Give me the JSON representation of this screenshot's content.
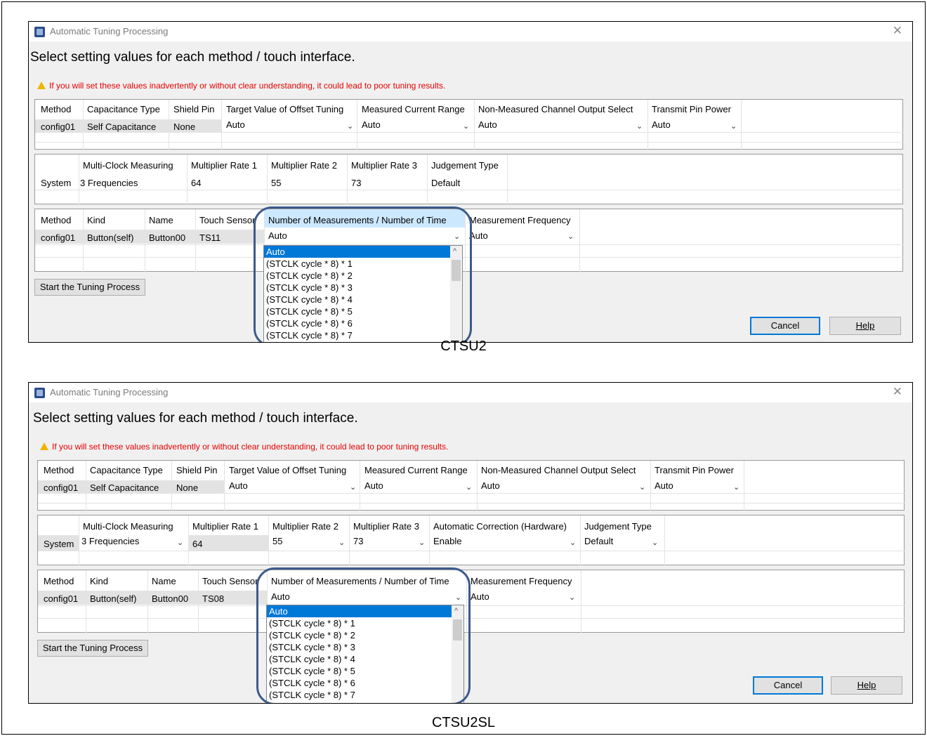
{
  "dialog_title": "Automatic Tuning Processing",
  "heading": "Select setting values for each method / touch interface.",
  "warning": "If you will set these values inadvertently or without clear understanding, it could lead to poor tuning results.",
  "method_table": {
    "headers": [
      "Method",
      "Capacitance Type",
      "Shield Pin",
      "Target Value of Offset Tuning",
      "Measured Current Range",
      "Non-Measured Channel Output Select",
      "Transmit Pin Power"
    ],
    "row": [
      "config01",
      "Self Capacitance",
      "None",
      "Auto",
      "Auto",
      "Auto",
      "Auto"
    ]
  },
  "ctsu2_system": {
    "headers": [
      "Multi-Clock Measuring",
      "Multiplier Rate 1",
      "Multiplier Rate 2",
      "Multiplier Rate 3",
      "Judgement Type"
    ],
    "row_label": "System",
    "values": [
      "3 Frequencies",
      "64",
      "55",
      "73",
      "Default"
    ]
  },
  "ctsu2sl_system": {
    "headers": [
      "Multi-Clock Measuring",
      "Multiplier Rate 1",
      "Multiplier Rate 2",
      "Multiplier Rate 3",
      "Automatic Correction (Hardware)",
      "Judgement Type"
    ],
    "row_label": "System",
    "values": [
      "3 Frequencies",
      "64",
      "55",
      "73",
      "Enable",
      "Default"
    ]
  },
  "touch_table": {
    "headers": [
      "Method",
      "Kind",
      "Name",
      "Touch Sensor",
      "Number of Measurements / Number of Time",
      "Measurement Frequency"
    ],
    "row": [
      "config01",
      "Button(self)",
      "Button00",
      "Auto",
      "Auto"
    ]
  },
  "ctsu2_touch_sensor": "TS11",
  "ctsu2sl_touch_sensor": "TS08",
  "dropdown_options": [
    "Auto",
    "(STCLK cycle * 8) * 1",
    "(STCLK cycle * 8) * 2",
    "(STCLK cycle * 8) * 3",
    "(STCLK cycle * 8) * 4",
    "(STCLK cycle * 8) * 5",
    "(STCLK cycle * 8) * 6",
    "(STCLK cycle * 8) * 7"
  ],
  "buttons": {
    "start": "Start the Tuning Process",
    "cancel": "Cancel",
    "help": "Help"
  },
  "captions": {
    "top": "CTSU2",
    "bottom": "CTSU2SL"
  },
  "colors": {
    "warning": "#e60000",
    "selection": "#0078d7",
    "highlight_ring": "#3c5a8a"
  }
}
